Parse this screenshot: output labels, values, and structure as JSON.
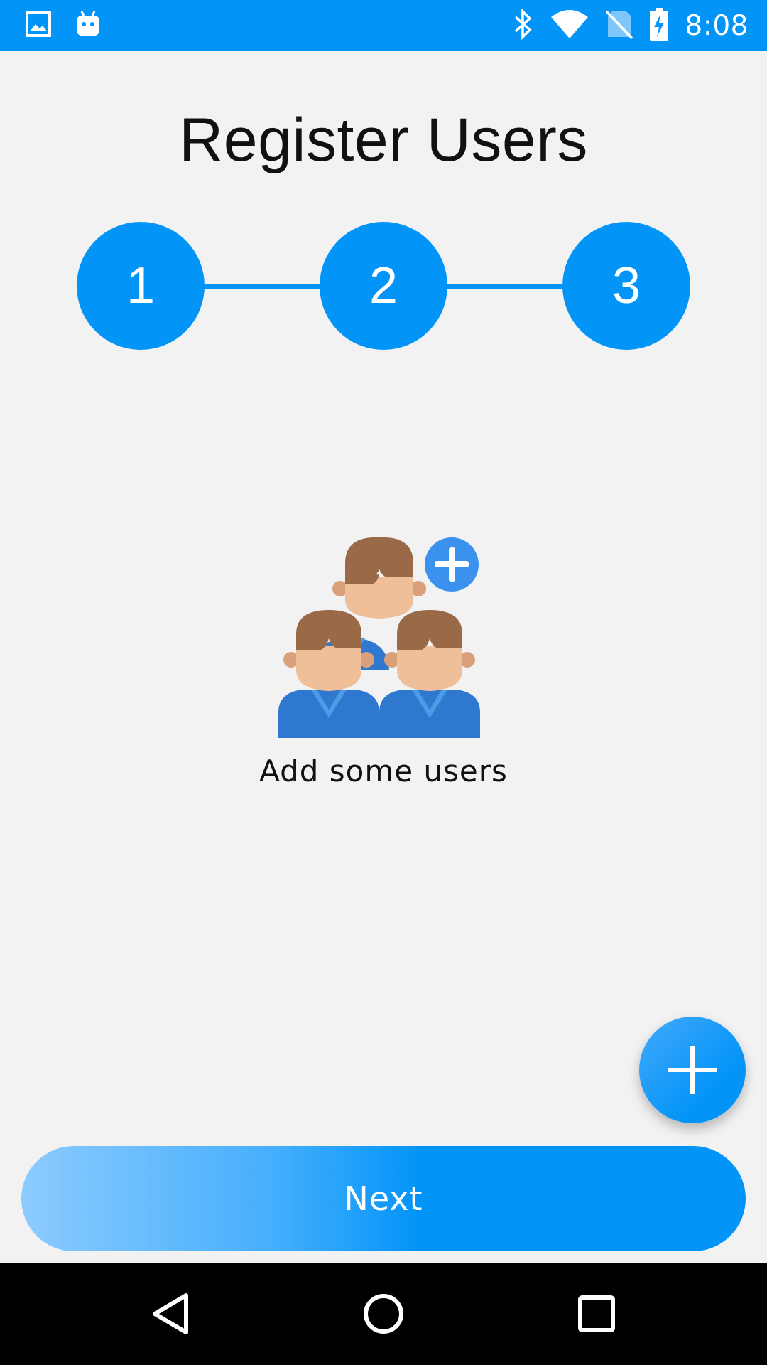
{
  "status_bar": {
    "time": "8:08",
    "icons": [
      "image-icon",
      "android-icon",
      "bluetooth-icon",
      "wifi-icon",
      "no-sim-icon",
      "battery-charging-icon"
    ]
  },
  "page": {
    "title": "Register Users"
  },
  "stepper": {
    "steps": [
      "1",
      "2",
      "3"
    ]
  },
  "empty_state": {
    "illustration": "users-add-icon",
    "text": "Add some users"
  },
  "fab": {
    "icon": "plus-icon"
  },
  "next_button": {
    "label": "Next"
  },
  "nav_bar": {
    "icons": [
      "back-icon",
      "home-icon",
      "recents-icon"
    ]
  },
  "colors": {
    "accent": "#0394f8",
    "background": "#f2f2f3",
    "hair": "#9a6a48",
    "skin": "#efbf99",
    "shirt": "#2f78cf"
  }
}
